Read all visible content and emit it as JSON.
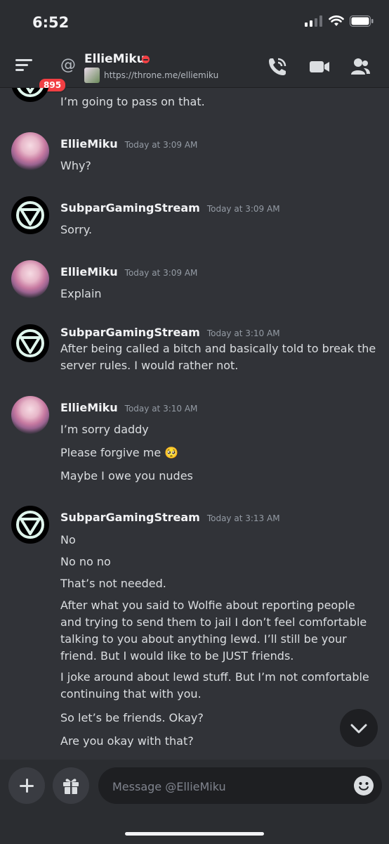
{
  "status_bar": {
    "time": "6:52"
  },
  "header": {
    "badge_count": "895",
    "channel_name": "EllieMiku",
    "status_text": "https://throne.me/elliemiku"
  },
  "messages": {
    "partial_line": "I’m going to pass on that.",
    "groups": [
      {
        "author": "EllieMiku",
        "time": "Today at 3:09 AM",
        "lines": [
          "Why?"
        ]
      },
      {
        "author": "SubparGamingStream",
        "time": "Today at 3:09 AM",
        "lines": [
          "Sorry."
        ]
      },
      {
        "author": "EllieMiku",
        "time": "Today at 3:09 AM",
        "lines": [
          "Explain"
        ]
      },
      {
        "author": "SubparGamingStream",
        "time": "Today at 3:10 AM",
        "lines": [
          "After being called a bitch and basically told to break the server rules. I would rather not."
        ]
      },
      {
        "author": "EllieMiku",
        "time": "Today at 3:10 AM",
        "lines": [
          "I’m sorry daddy",
          "Please forgive me 🥺",
          "Maybe I owe you nudes"
        ]
      },
      {
        "author": "SubparGamingStream",
        "time": "Today at 3:13 AM",
        "lines": [
          "No",
          "No no no",
          "That’s not needed.",
          "After what you said to Wolfie about reporting people and trying to send them to jail I don’t feel comfortable talking to you about anything lewd. I’ll still be your friend. But I would like to be JUST friends.",
          "I joke around about lewd stuff. But I’m not comfortable continuing that with you.",
          "So let’s be friends. Okay?",
          "Are you okay with that?"
        ]
      }
    ]
  },
  "composer": {
    "placeholder": "Message @EllieMiku"
  },
  "colors": {
    "background": "#313338",
    "header": "#2b2d31",
    "badge": "#f23f43",
    "accent_icon": "#dff5ec"
  }
}
